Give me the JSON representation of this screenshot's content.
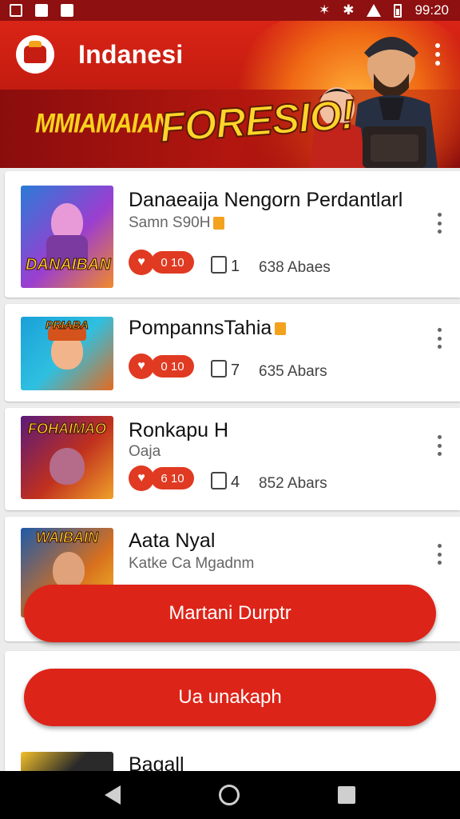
{
  "status_bar": {
    "time": "99:20"
  },
  "header": {
    "title": "Indanesi",
    "banner_sub": "MMIAMAIAN",
    "banner_main": "FORESIO!"
  },
  "items": [
    {
      "title": "Danaeaija Nengorn Perdantlarl",
      "subtitle": "Samn S90H",
      "likes": "0 10",
      "comments": "1",
      "views": "638 Abaes",
      "thumb_text": "DANAIBAN"
    },
    {
      "title": "PompannsTahia",
      "subtitle": "",
      "likes": "0 10",
      "comments": "7",
      "views": "635 Abars",
      "thumb_text": "PRIABA"
    },
    {
      "title": "Ronkapu H",
      "subtitle": "Oaja",
      "likes": "6 10",
      "comments": "4",
      "views": "852 Abars",
      "thumb_text": "FOHAIMAO"
    },
    {
      "title": "Aata Nyal",
      "subtitle": "Katke Ca Mgadnm",
      "likes": "",
      "comments": "",
      "views": "",
      "thumb_text": "WAIBAIN"
    },
    {
      "title": "Bagall",
      "subtitle": "",
      "likes": "",
      "comments": "",
      "views": "",
      "thumb_text": ""
    }
  ],
  "buttons": {
    "primary": "Martani Durptr",
    "secondary": "Ua unakaph"
  },
  "colors": {
    "brand": "#dd2418",
    "banner_text": "#ffd42a"
  }
}
